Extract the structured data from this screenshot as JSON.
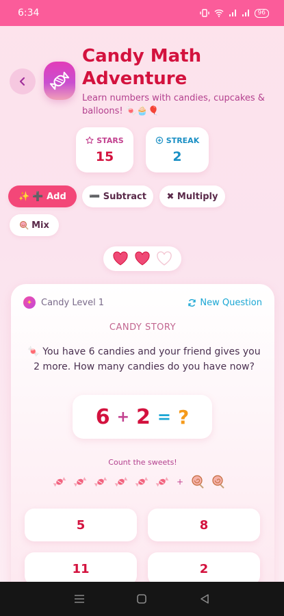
{
  "status_bar": {
    "time": "6:34",
    "battery": "96"
  },
  "header": {
    "title": "Candy Math Adventure",
    "subtitle": "Learn numbers with candies, cupcakes & balloons! 🍬🧁🎈"
  },
  "stats": {
    "stars": {
      "label": "STARS",
      "value": "15",
      "color": "#d3123e"
    },
    "streak": {
      "label": "STREAK",
      "value": "2",
      "color": "#1a8fc4"
    }
  },
  "modes": {
    "add": "➕ Add",
    "subtract": "➖ Subtract",
    "multiply": "✖ Multiply",
    "mix": "Mix"
  },
  "lives": {
    "filled": 2,
    "total": 3
  },
  "question_card": {
    "level": "Candy Level 1",
    "new_question": "New Question",
    "story_label": "CANDY STORY",
    "story": "🍬 You have 6 candies and your friend gives you 2 more. How many candies do you have now?",
    "equation": {
      "a": "6",
      "op": "+",
      "b": "2",
      "eq": "=",
      "unknown": "?"
    },
    "count_label": "Count the sweets!",
    "answers": [
      "5",
      "8",
      "11",
      "2"
    ]
  },
  "colors": {
    "accent": "#f34778",
    "title": "#d3123e",
    "status_bar": "#fb5c9a"
  }
}
